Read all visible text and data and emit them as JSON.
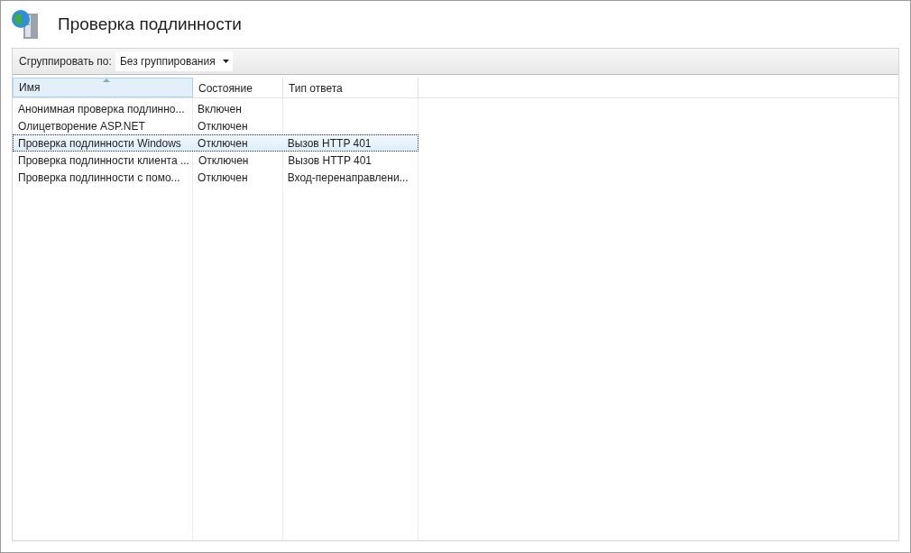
{
  "page": {
    "title": "Проверка подлинности"
  },
  "toolbar": {
    "group_label": "Сгруппировать по:",
    "group_value": "Без группирования"
  },
  "table": {
    "columns": [
      {
        "label": "Имя",
        "sorted": true
      },
      {
        "label": "Состояние",
        "sorted": false
      },
      {
        "label": "Тип ответа",
        "sorted": false
      }
    ],
    "rows": [
      {
        "cells": [
          "Анонимная проверка подлинно...",
          "Включен",
          ""
        ],
        "selected": false
      },
      {
        "cells": [
          "Олицетворение ASP.NET",
          "Отключен",
          ""
        ],
        "selected": false
      },
      {
        "cells": [
          "Проверка подлинности Windows",
          "Отключен",
          "Вызов HTTP 401"
        ],
        "selected": true
      },
      {
        "cells": [
          "Проверка подлинности клиента ...",
          "Отключен",
          "Вызов HTTP 401"
        ],
        "selected": false
      },
      {
        "cells": [
          "Проверка подлинности с помо...",
          "Отключен",
          "Вход-перенаправлени..."
        ],
        "selected": false
      }
    ]
  }
}
